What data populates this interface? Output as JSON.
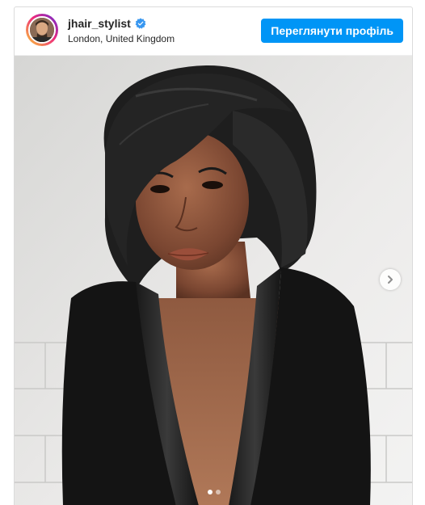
{
  "header": {
    "username": "jhair_stylist",
    "location": "London, United Kingdom",
    "view_profile_label": "Переглянути профіль",
    "verified": true
  },
  "media": {
    "icon": "photo-portrait",
    "carousel_total": 2,
    "carousel_active": 1,
    "next_icon": "chevron-right-icon"
  },
  "colors": {
    "button_blue": "#0095f6",
    "verified_blue": "#3897f0",
    "border": "#dbdbdb",
    "text": "#262626"
  }
}
